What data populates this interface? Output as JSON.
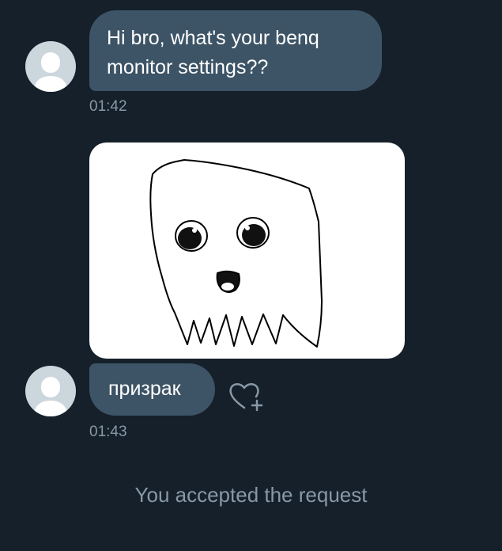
{
  "conversation": {
    "messages": [
      {
        "text": "Hi bro, what's your benq monitor settings??",
        "time": "01:42"
      },
      {
        "image": "ghost-drawing",
        "caption": "призрак",
        "time": "01:43"
      }
    ],
    "system_message": "You accepted the request"
  },
  "icons": {
    "avatar": "default-user-avatar-icon",
    "reaction": "heart-plus-icon"
  },
  "colors": {
    "background": "#15202b",
    "bubble": "#3d5466",
    "muted_text": "#8899a6",
    "avatar_bg": "#ccd6dd"
  }
}
